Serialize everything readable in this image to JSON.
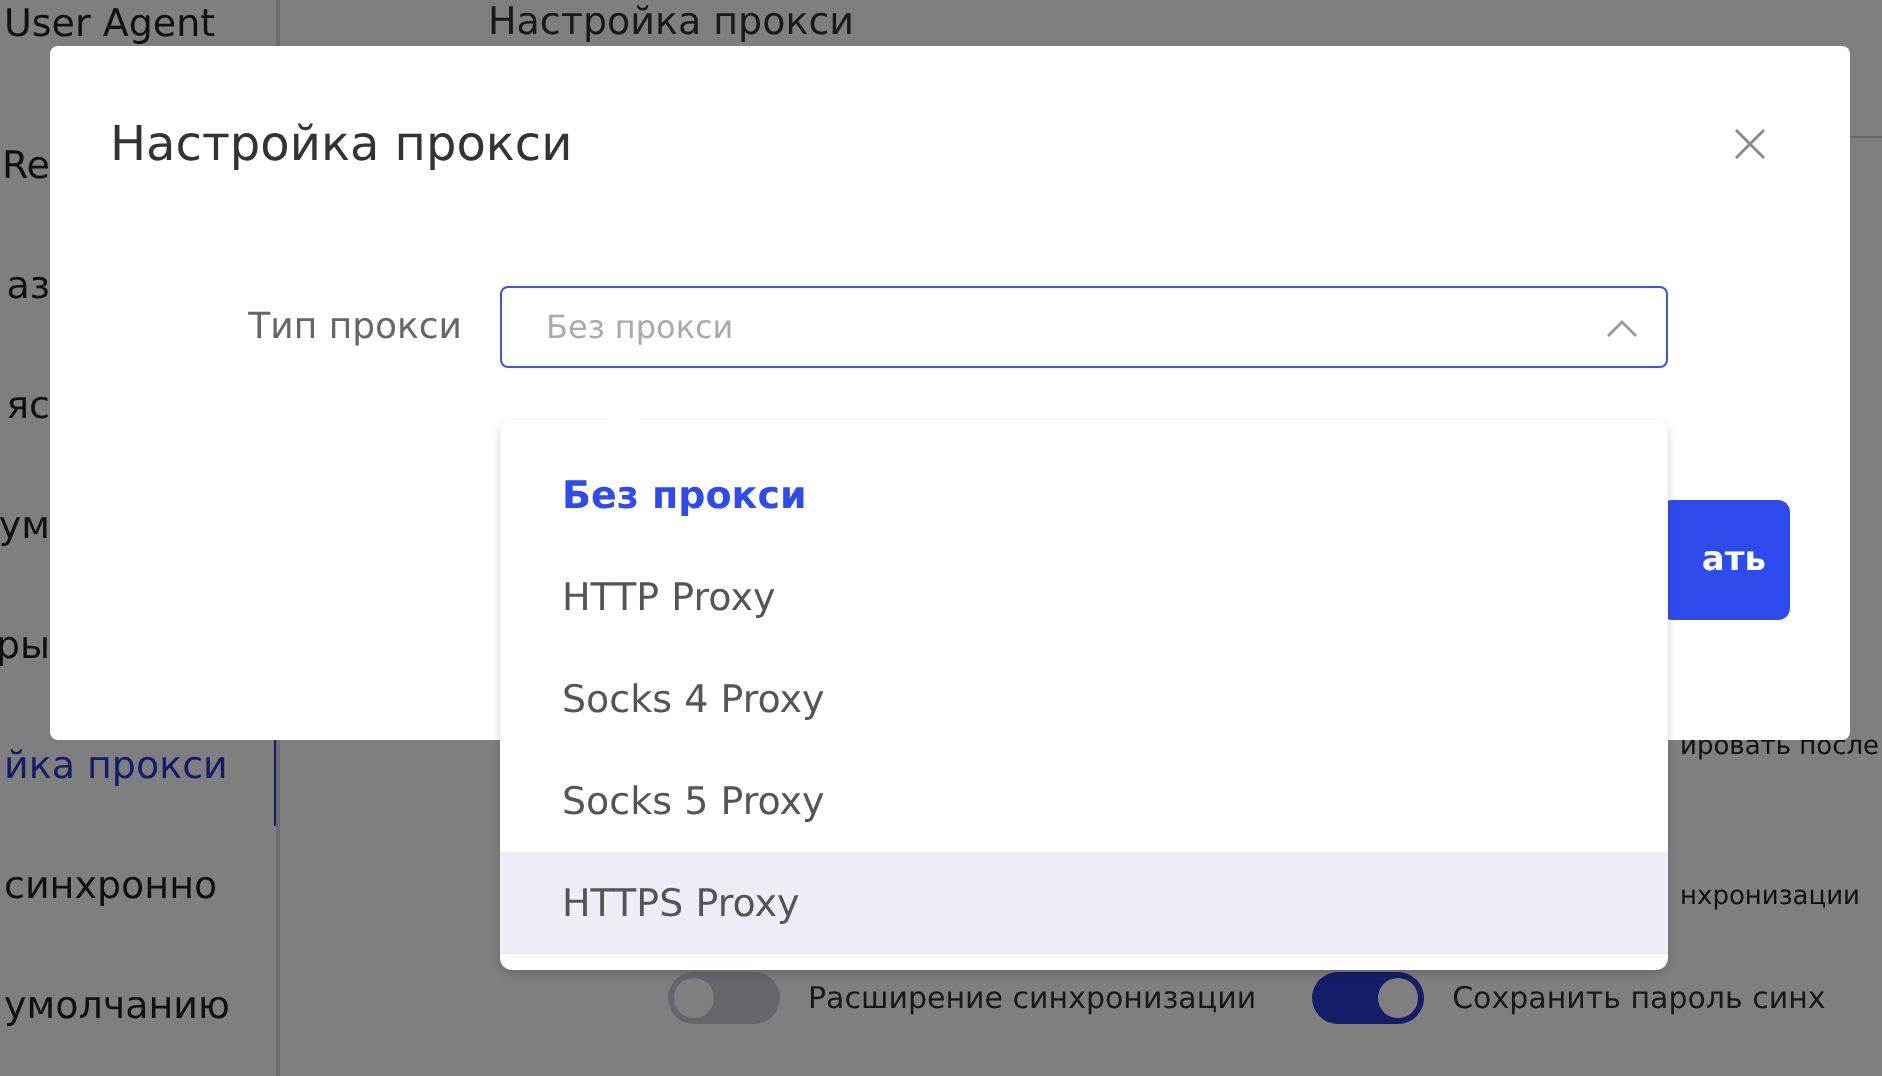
{
  "sidebar": {
    "items": [
      {
        "label": "User Agent",
        "selected": false
      },
      {
        "label": "Re",
        "selected": false
      },
      {
        "label": "аз",
        "selected": false
      },
      {
        "label": "яс",
        "selected": false
      },
      {
        "label": "ум",
        "selected": false
      },
      {
        "label": "ры",
        "selected": false
      },
      {
        "label": "йка прокси",
        "selected": true
      },
      {
        "label": "синхронно",
        "selected": false
      },
      {
        "label": "умолчанию",
        "selected": false
      }
    ]
  },
  "page": {
    "title": "Настройка прокси",
    "texts": [
      "ировать после",
      "нхронизации"
    ],
    "toggles": [
      {
        "label": "Расширение синхронизации",
        "on": false
      },
      {
        "label": "Сохранить пароль синх",
        "on": true
      }
    ]
  },
  "dialog": {
    "title": "Настройка прокси",
    "field": {
      "label": "Тип прокси",
      "placeholder": "Без прокси",
      "expanded": true
    },
    "options": [
      {
        "label": "Без прокси",
        "selected": true,
        "hovered": false
      },
      {
        "label": "HTTP Proxy",
        "selected": false,
        "hovered": false
      },
      {
        "label": "Socks 4 Proxy",
        "selected": false,
        "hovered": false
      },
      {
        "label": "Socks 5 Proxy",
        "selected": false,
        "hovered": false
      },
      {
        "label": "HTTPS Proxy",
        "selected": false,
        "hovered": true
      }
    ],
    "button": "ать"
  }
}
